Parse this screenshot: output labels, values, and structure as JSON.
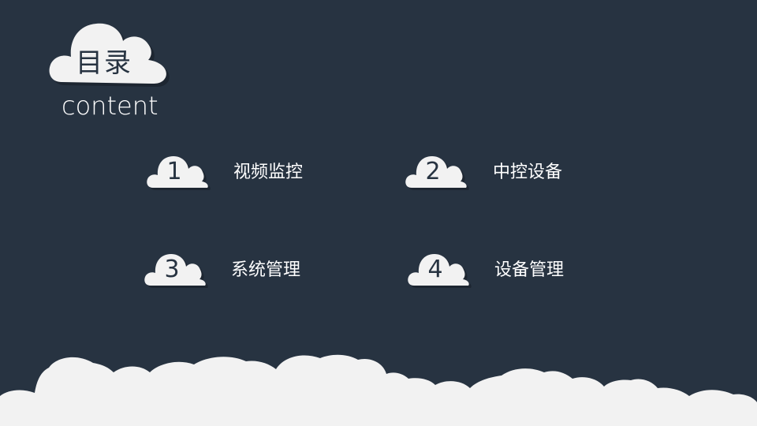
{
  "header": {
    "title": "目录",
    "subtitle": "content"
  },
  "menu": {
    "items": [
      {
        "number": "1",
        "label": "视频监控"
      },
      {
        "number": "2",
        "label": "中控设备"
      },
      {
        "number": "3",
        "label": "系统管理"
      },
      {
        "number": "4",
        "label": "设备管理"
      }
    ]
  },
  "colors": {
    "background": "#273341",
    "cloud": "#f2f2f2",
    "text_light": "#ffffff",
    "text_dark": "#273341"
  },
  "icons": {
    "title_cloud": "cloud-icon",
    "item_cloud": "cloud-icon",
    "bottom_bank": "cloud-bank-decoration"
  }
}
